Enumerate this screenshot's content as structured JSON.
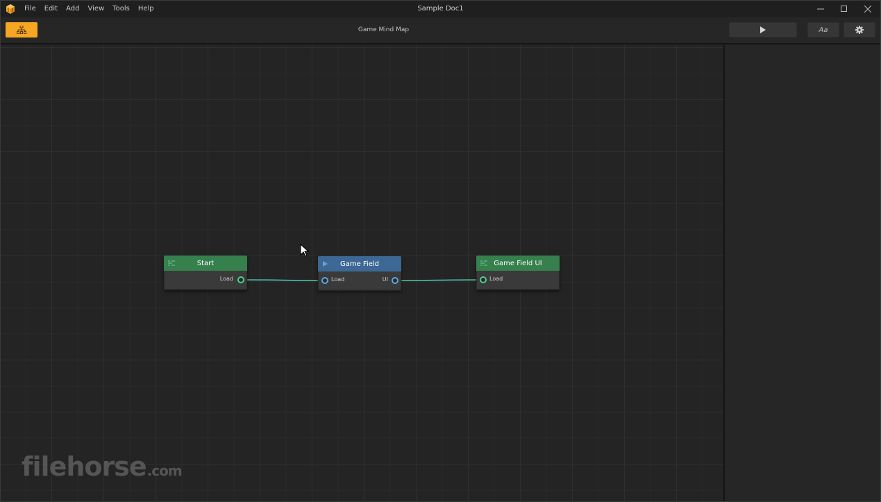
{
  "window": {
    "title": "Sample Doc1",
    "menu": [
      "File",
      "Edit",
      "Add",
      "View",
      "Tools",
      "Help"
    ]
  },
  "toolbar": {
    "title": "Game Mind Map",
    "mindmap_icon": "hierarchy-icon",
    "play_icon": "play-icon",
    "font_label": "Aa",
    "settings_icon": "gear-icon"
  },
  "nodes": {
    "start": {
      "title": "Start",
      "output_port": "Load",
      "color": "#35804d"
    },
    "game_field": {
      "title": "Game Field",
      "input_port": "Load",
      "output_port": "UI",
      "color": "#3d6896"
    },
    "game_field_ui": {
      "title": "Game Field UI",
      "input_port": "Load",
      "color": "#35804d"
    }
  },
  "watermark": {
    "main": "filehorse",
    "suffix": ".com"
  },
  "colors": {
    "accent": "#f5a623",
    "connection": "#4ec9b0",
    "port_green": "#4cd08a",
    "port_blue": "#59a8e8"
  }
}
